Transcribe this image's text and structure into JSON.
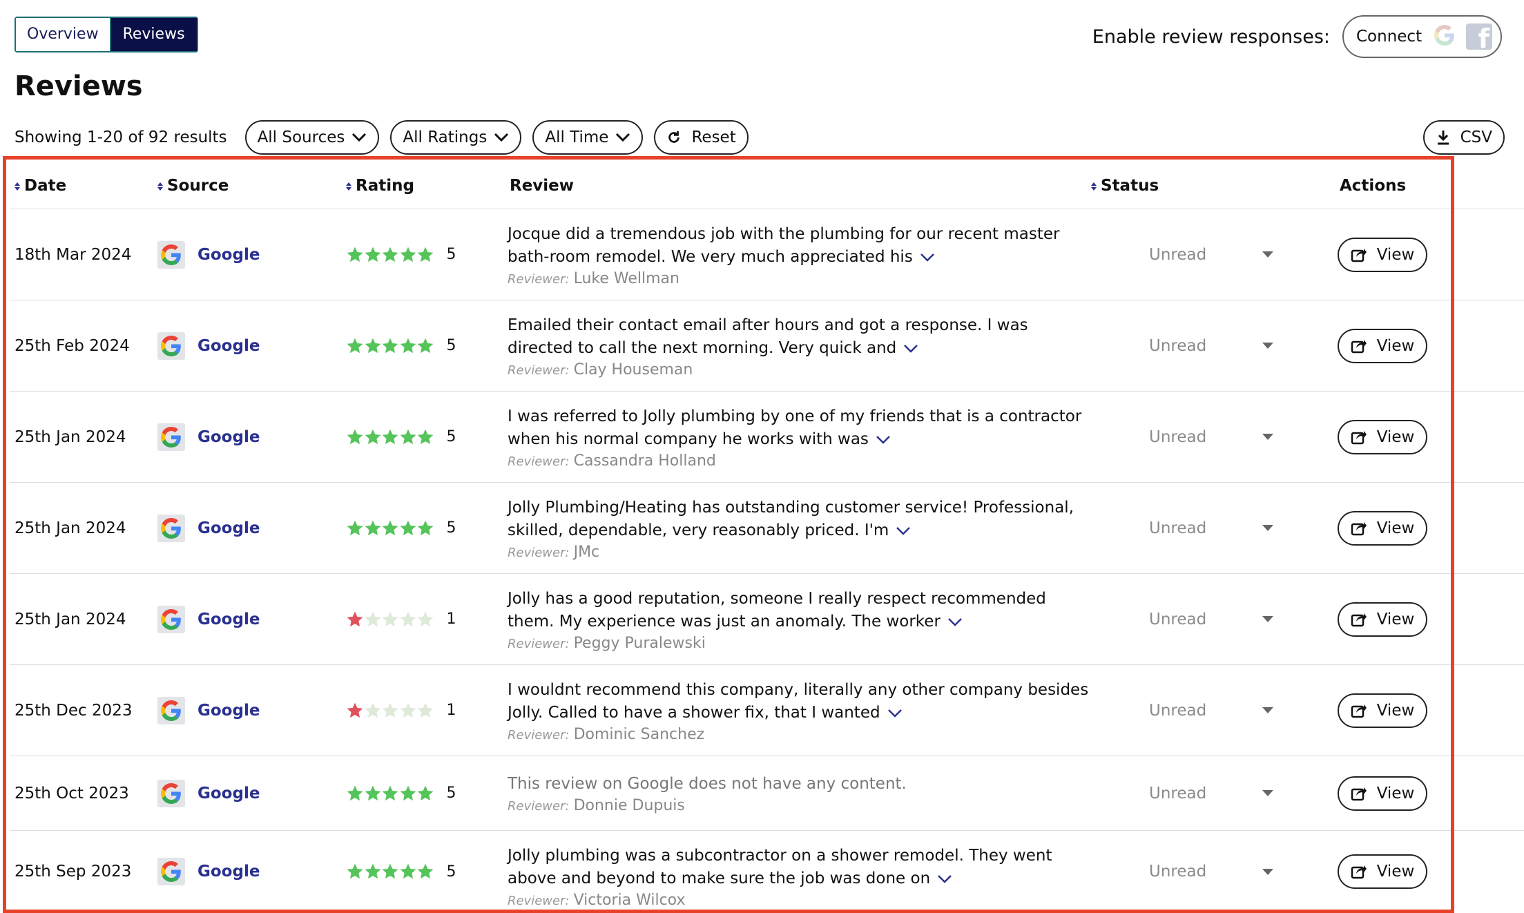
{
  "tabs": {
    "overview": "Overview",
    "reviews": "Reviews"
  },
  "enable": {
    "label": "Enable review responses:",
    "connect": "Connect"
  },
  "page_title": "Reviews",
  "filters": {
    "showing": "Showing 1-20 of 92 results",
    "sources": "All Sources",
    "ratings": "All Ratings",
    "time": "All Time",
    "reset": "Reset",
    "csv": "CSV"
  },
  "table": {
    "headers": {
      "date": "Date",
      "source": "Source",
      "rating": "Rating",
      "review": "Review",
      "status": "Status",
      "actions": "Actions"
    },
    "reviewer_label": "Reviewer:",
    "view_label": "View",
    "rows": [
      {
        "date": "18th Mar 2024",
        "source": "Google",
        "rating": 5,
        "rating_text": "5",
        "review": "Jocque did a tremendous job with the plumbing for our recent master bath-room remodel. We very much appreciated his",
        "reviewer": "Luke Wellman",
        "status": "Unread"
      },
      {
        "date": "25th Feb 2024",
        "source": "Google",
        "rating": 5,
        "rating_text": "5",
        "review": "Emailed their contact email after hours and got a response. I was directed to call the next morning. Very quick and",
        "reviewer": "Clay Houseman",
        "status": "Unread"
      },
      {
        "date": "25th Jan 2024",
        "source": "Google",
        "rating": 5,
        "rating_text": "5",
        "review": "I was referred to Jolly plumbing by one of my friends that is a contractor when his normal company he works with was",
        "reviewer": "Cassandra Holland",
        "status": "Unread"
      },
      {
        "date": "25th Jan 2024",
        "source": "Google",
        "rating": 5,
        "rating_text": "5",
        "review": "Jolly Plumbing/Heating has outstanding customer service! Professional, skilled, dependable, very reasonably priced. I'm",
        "reviewer": "JMc",
        "status": "Unread"
      },
      {
        "date": "25th Jan 2024",
        "source": "Google",
        "rating": 1,
        "rating_text": "1",
        "review": "Jolly has a good reputation, someone I really respect recommended them. My experience was just an anomaly. The worker",
        "reviewer": "Peggy Puralewski",
        "status": "Unread"
      },
      {
        "date": "25th Dec 2023",
        "source": "Google",
        "rating": 1,
        "rating_text": "1",
        "review": "I wouldnt recommend this company, literally any other company besides Jolly. Called to have a shower fix, that I wanted",
        "reviewer": "Dominic Sanchez",
        "status": "Unread"
      },
      {
        "date": "25th Oct 2023",
        "source": "Google",
        "rating": 5,
        "rating_text": "5",
        "review": "This review on Google does not have any content.",
        "reviewer": "Donnie Dupuis",
        "status": "Unread",
        "empty": true
      },
      {
        "date": "25th Sep 2023",
        "source": "Google",
        "rating": 5,
        "rating_text": "5",
        "review": "Jolly plumbing was a subcontractor on a shower remodel. They went above and beyond to make sure the job was done on",
        "reviewer": "Victoria Wilcox",
        "status": "Unread"
      }
    ]
  },
  "colors": {
    "star_on": "#55c45a",
    "star_low": "#e0525b",
    "star_off": "#dfe9d8",
    "highlight": "#e8412a",
    "nav_active": "#0b0f47",
    "link": "#2a3190"
  },
  "icons": {
    "google": "google-g-icon",
    "facebook": "facebook-icon",
    "chevron": "chevron-down-icon",
    "reset": "refresh-icon",
    "download": "download-icon",
    "share": "external-share-icon",
    "caret": "caret-down-icon",
    "sort": "sort-icon",
    "star": "star-icon"
  }
}
